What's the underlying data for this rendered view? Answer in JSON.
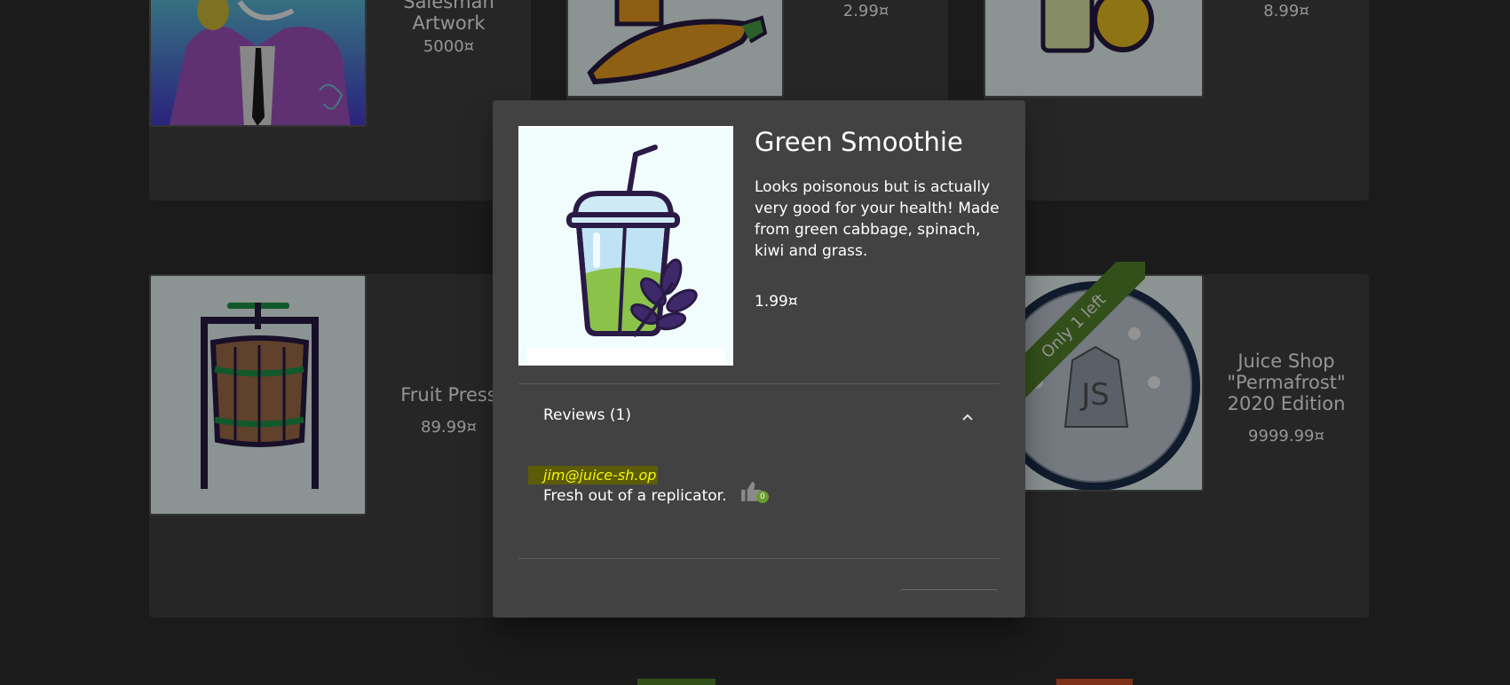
{
  "products": [
    {
      "title": "Salesman Artwork",
      "title_lines": [
        "Salesman",
        "Artwork"
      ],
      "price": "5000¤"
    },
    {
      "title": "",
      "price": "2.99¤"
    },
    {
      "title": "",
      "price": "8.99¤"
    },
    {
      "title": "Fruit Press",
      "price": "89.99¤"
    },
    {
      "title": "Juice Shop \"Permafrost\" 2020 Edition",
      "title_lines": [
        "Juice Shop",
        "\"Permafrost\"",
        "2020 Edition"
      ],
      "price": "9999.99¤",
      "ribbon": "Only 1 left"
    }
  ],
  "dialog": {
    "title": "Green Smoothie",
    "description": "Looks poisonous but is actually very good for your health! Made from green cabbage, spinach, kiwi and grass.",
    "price": "1.99¤",
    "reviews_label": "Reviews (1)",
    "reviews": [
      {
        "author": "jim@juice-sh.op",
        "text": "Fresh out of a replicator.",
        "likes": "0"
      }
    ],
    "icons": {
      "collapse": "chevron-up-icon",
      "like": "thumbs-up-icon"
    }
  },
  "colors": {
    "background": "#303030",
    "card": "#424242",
    "ribbon": "#5b8a2e",
    "author_highlight": "#f5f50e",
    "like_badge": "#6a9a2f"
  }
}
